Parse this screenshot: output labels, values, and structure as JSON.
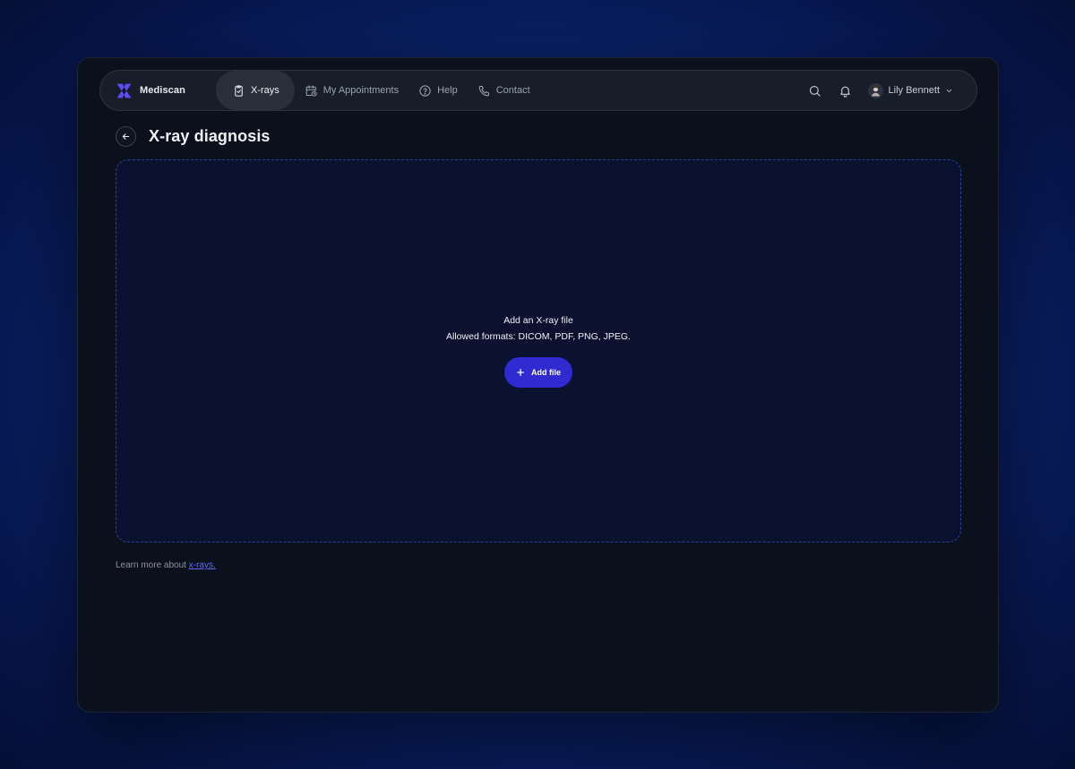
{
  "brand": {
    "name": "Mediscan"
  },
  "nav": {
    "items": [
      {
        "label": "X-rays",
        "icon": "clipboard-check-icon",
        "active": true
      },
      {
        "label": "My Appointments",
        "icon": "calendar-clock-icon",
        "active": false
      },
      {
        "label": "Help",
        "icon": "help-circle-icon",
        "active": false
      },
      {
        "label": "Contact",
        "icon": "phone-icon",
        "active": false
      }
    ],
    "search_icon": "search-icon",
    "notifications_icon": "bell-icon"
  },
  "user": {
    "name": "Lily Bennett",
    "avatar_icon": "avatar",
    "menu_icon": "chevron-down-icon"
  },
  "page": {
    "title": "X-ray diagnosis",
    "back_icon": "arrow-left-icon"
  },
  "upload": {
    "title": "Add an X-ray file",
    "formats": "Allowed formats: DICOM, PDF, PNG, JPEG.",
    "button_label": "Add file",
    "button_icon": "plus-icon"
  },
  "footer": {
    "text": "Learn more about",
    "link_label": "x-rays."
  },
  "colors": {
    "accent": "#2f2bd0",
    "brand_logo": "#5b4dff",
    "link": "#5b6cf5",
    "dropzone_border": "#27449a",
    "window_bg": "#0b111c"
  }
}
